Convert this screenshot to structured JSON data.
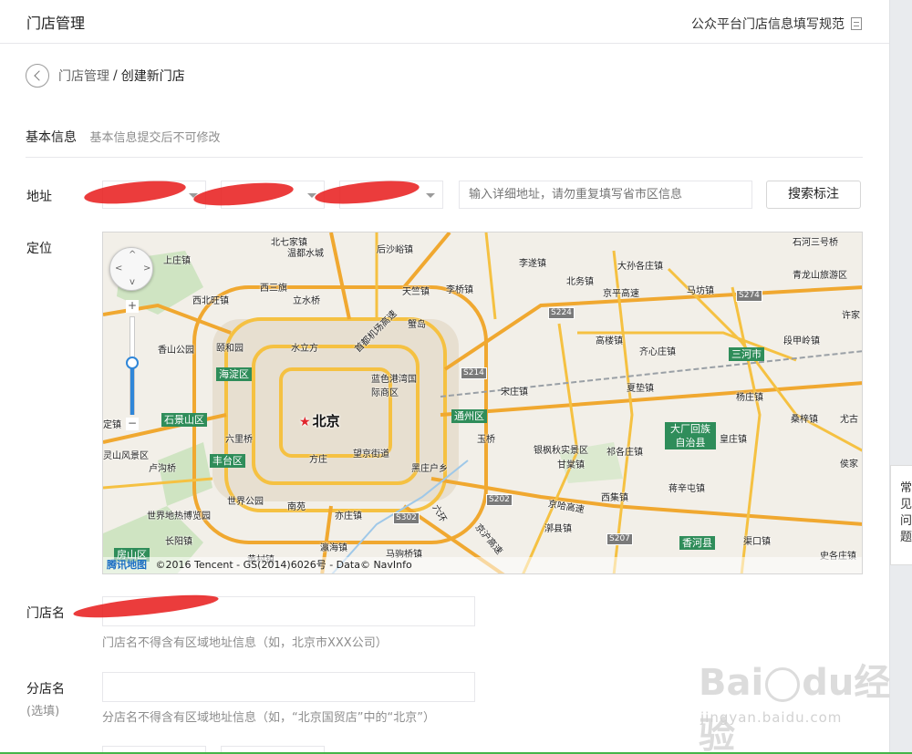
{
  "header": {
    "title": "门店管理",
    "spec_link": "公众平台门店信息填写规范",
    "spec_icon": "document-icon"
  },
  "breadcrumb": {
    "back_icon": "back-circle-icon",
    "parent": "门店管理",
    "separator": "/",
    "current": "创建新门店"
  },
  "basic_info": {
    "heading": "基本信息",
    "subheading": "基本信息提交后不可修改"
  },
  "address": {
    "label": "地址",
    "search_placeholder": "输入详细地址，请勿重复填写省市区信息",
    "search_button": "搜索标注"
  },
  "location": {
    "label": "定位",
    "map": {
      "city": "北京",
      "copyright": "©2016 Tencent - GS(2014)6026号 - Data© NavInfo",
      "logo": "腾讯地图",
      "zoom_in": "+",
      "zoom_out": "−",
      "pan_arrows": [
        "^",
        "v",
        "<",
        ">"
      ],
      "accent_color": "#2f86d8",
      "districts": [
        "海淀区",
        "石景山区",
        "丰台区",
        "通州区",
        "房山区",
        "三河市",
        "大厂回族自治县",
        "香河县"
      ],
      "places": [
        "北七家镇",
        "温都水城",
        "后沙峪镇",
        "石河三号桥",
        "上庄镇",
        "李遂镇",
        "大孙各庄镇",
        "青龙山旅游区",
        "西三旗",
        "天竺镇",
        "北务镇",
        "西北旺镇",
        "立水桥",
        "李桥镇",
        "京平高速",
        "马坊镇",
        "高楼镇",
        "许家",
        "香山公园",
        "颐和园",
        "水立方",
        "蓝色港湾国际商区",
        "首都机场高速",
        "蟹岛",
        "齐心庄镇",
        "段甲岭镇",
        "夏垫镇",
        "宋庄镇",
        "杨庄镇",
        "尤古",
        "桑梓镇",
        "六里桥",
        "玉桥",
        "皇庄镇",
        "灵山风景区",
        "方庄",
        "望京街道",
        "银枫秋实景区",
        "祁各庄镇",
        "卢沟桥",
        "黑庄户乡",
        "甘棠镇",
        "侯家",
        "世界公园",
        "蒋辛屯镇",
        "南苑",
        "西集镇",
        "世界地热博览园",
        "亦庄镇",
        "漷县镇",
        "长阳镇",
        "瀛海镇",
        "渠口镇",
        "黄村镇",
        "马驹桥镇",
        "史各庄镇",
        "京沪高速",
        "定镇",
        "京哈高速",
        "六环"
      ],
      "highways": [
        "S224",
        "S274",
        "S214",
        "S202",
        "S302",
        "S207"
      ]
    }
  },
  "store_name": {
    "label": "门店名",
    "tip": "门店名不得含有区域地址信息（如，北京市XXX公司）"
  },
  "branch_name": {
    "label": "分店名",
    "optional": "(选填)",
    "tip": "分店名不得含有区域地址信息（如，“北京国贸店”中的“北京”）"
  },
  "sidebar": {
    "faq_tab": "常见问题"
  },
  "watermark": {
    "text_a": "Bai",
    "text_b": "du",
    "text_c": "经验",
    "url": "jingyan.baidu.com"
  }
}
